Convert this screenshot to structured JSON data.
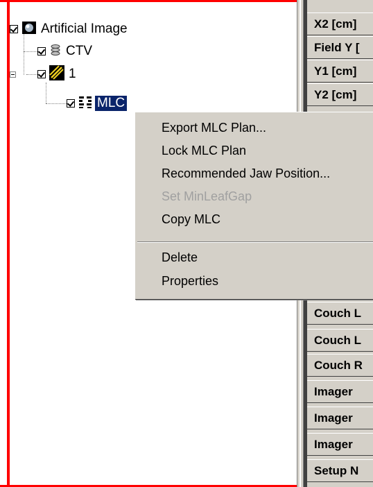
{
  "tree": {
    "nodes": [
      {
        "label": "Artificial Image",
        "checked": true,
        "icon": "artificial-image-icon"
      },
      {
        "label": "CTV",
        "checked": true,
        "icon": "structure-stack-icon"
      },
      {
        "label": "1",
        "checked": true,
        "icon": "beam-icon",
        "expanded": true
      },
      {
        "label": "MLC",
        "checked": true,
        "icon": "mlc-icon",
        "selected": true
      }
    ]
  },
  "context_menu": {
    "items": [
      {
        "label": "Export MLC Plan...",
        "enabled": true
      },
      {
        "label": "Lock MLC Plan",
        "enabled": true
      },
      {
        "label": "Recommended Jaw Position...",
        "enabled": true
      },
      {
        "label": "Set MinLeafGap",
        "enabled": false
      },
      {
        "label": "Copy MLC",
        "enabled": true
      },
      {
        "label": "Delete",
        "enabled": true
      },
      {
        "label": "Properties",
        "enabled": true
      }
    ]
  },
  "grid": {
    "rows": [
      "X2 [cm]",
      "Field Y [",
      "Y1 [cm]",
      "Y2 [cm]",
      "Couch L",
      "Couch L",
      "Couch R",
      "Imager",
      "Imager",
      "Imager",
      "Setup N"
    ]
  },
  "colors": {
    "highlight": "#0a246a",
    "frame_red": "#ff0000",
    "menu_bg": "#d4d0c8"
  }
}
